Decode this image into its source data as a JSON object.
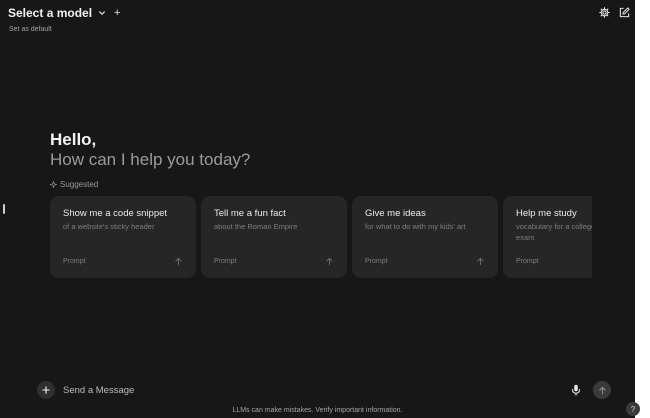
{
  "header": {
    "model_select_label": "Select a model",
    "add_model_symbol": "+",
    "set_default_label": "Set as default",
    "icons": [
      "chevron-down-icon",
      "plus-icon",
      "gear-icon",
      "edit-icon"
    ]
  },
  "hero": {
    "greeting": "Hello,",
    "subtitle": "How can I help you today?"
  },
  "suggested": {
    "label": "Suggested",
    "cards": [
      {
        "title": "Show me a code snippet",
        "subtitle": "of a website's sticky header",
        "footer": "Prompt"
      },
      {
        "title": "Tell me a fun fact",
        "subtitle": "about the Roman Empire",
        "footer": "Prompt"
      },
      {
        "title": "Give me ideas",
        "subtitle": "for what to do with my kids' art",
        "footer": "Prompt"
      },
      {
        "title": "Help me study",
        "subtitle": "vocabulary for a college entrance exam",
        "footer": "Prompt"
      }
    ]
  },
  "composer": {
    "placeholder": "Send a Message"
  },
  "footer": {
    "disclaimer": "LLMs can make mistakes. Verify important information.",
    "help_label": "?"
  },
  "colors": {
    "background": "#171717",
    "card": "#262626",
    "text": "#ececec",
    "muted": "#9b9b9b"
  }
}
